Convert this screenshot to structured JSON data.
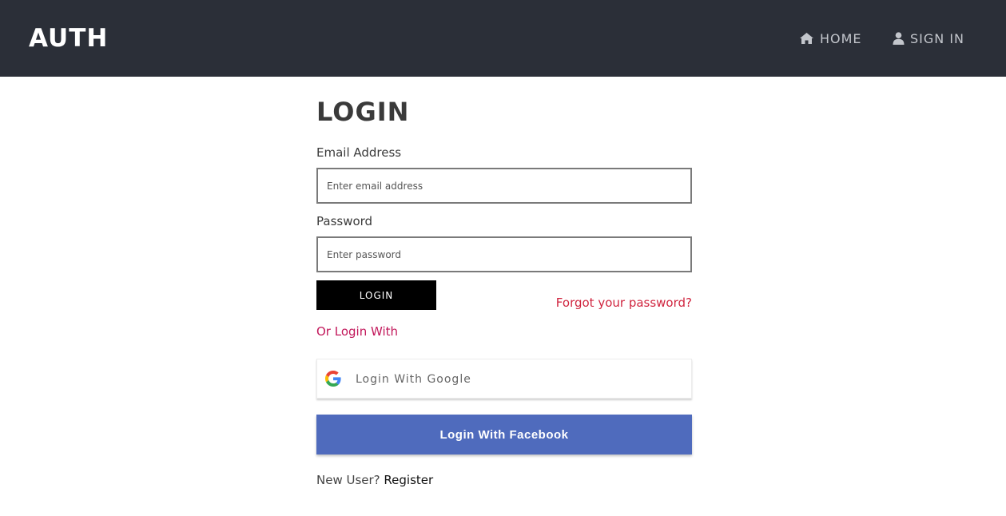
{
  "navbar": {
    "brand": "AUTH",
    "links": [
      {
        "label": "HOME",
        "icon": "home-icon"
      },
      {
        "label": "SIGN IN",
        "icon": "user-icon"
      }
    ],
    "background": "#2b2f38"
  },
  "login": {
    "title": "LOGIN",
    "email_label": "Email Address",
    "email_placeholder": "Enter email address",
    "email_value": "",
    "password_label": "Password",
    "password_placeholder": "Enter password",
    "password_value": "",
    "login_button": "LOGIN",
    "forgot_link": "Forgot your password?",
    "or_login_with": "Or Login With",
    "google_button": "Login With Google",
    "facebook_button": "Login With Facebook",
    "new_user_text": "New User?",
    "register_link": "Register"
  },
  "colors": {
    "accent_red": "#d0253f",
    "facebook_blue": "#4f6bbd",
    "button_black": "#000000"
  }
}
